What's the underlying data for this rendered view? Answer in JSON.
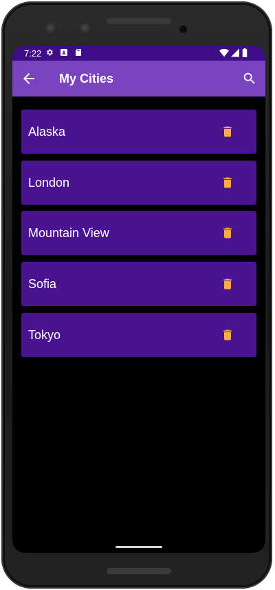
{
  "status_bar": {
    "time": "7:22",
    "left_icons": [
      "settings-icon",
      "a-notification-icon",
      "sd-card-icon"
    ],
    "right_icons": [
      "wifi-icon",
      "signal-icon",
      "battery-icon"
    ]
  },
  "app_bar": {
    "title": "My Cities",
    "nav_icon": "arrow-back-icon",
    "action_icon": "search-icon"
  },
  "cities": [
    {
      "name": "Alaska",
      "action_icon": "trash-icon"
    },
    {
      "name": "London",
      "action_icon": "trash-icon"
    },
    {
      "name": "Mountain View",
      "action_icon": "trash-icon"
    },
    {
      "name": "Sofia",
      "action_icon": "trash-icon"
    },
    {
      "name": "Tokyo",
      "action_icon": "trash-icon"
    }
  ],
  "colors": {
    "status_bar": "#3f0e86",
    "app_bar": "#7a43bf",
    "list_item": "#4a1490",
    "delete_icon": "#ffa94d",
    "background": "#000000"
  }
}
